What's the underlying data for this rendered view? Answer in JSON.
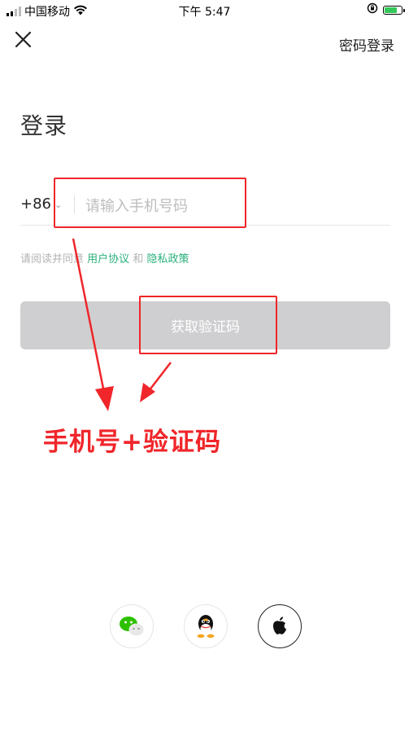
{
  "status_bar": {
    "carrier": "中国移动",
    "time": "下午 5:47"
  },
  "header": {
    "close_icon": "close-icon",
    "password_login_label": "密码登录"
  },
  "page": {
    "title": "登录"
  },
  "phone": {
    "country_code": "+86",
    "placeholder": "请输入手机号码"
  },
  "agreement": {
    "prefix": "请阅读并同意",
    "user_agreement": "用户协议",
    "and": "和",
    "privacy_policy": "隐私政策"
  },
  "get_code_button": {
    "label": "获取验证码"
  },
  "annotation": {
    "label": "手机号+验证码",
    "color": "#f0262a"
  },
  "social_login": {
    "items": [
      {
        "icon": "wechat-icon"
      },
      {
        "icon": "qq-icon"
      },
      {
        "icon": "apple-icon"
      }
    ]
  },
  "colors": {
    "link": "#2ab07a",
    "button_disabled": "#cfcfd1"
  }
}
